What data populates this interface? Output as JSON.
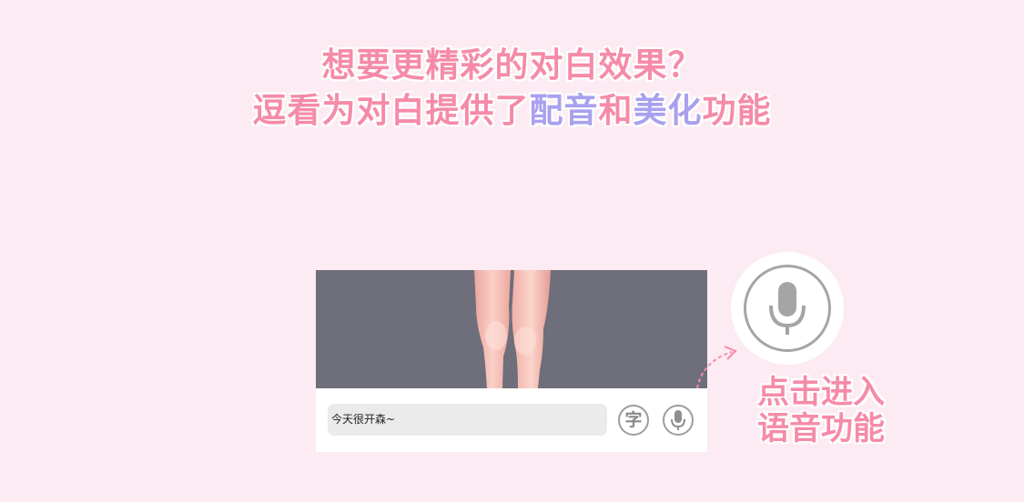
{
  "headline": {
    "line1": "想要更精彩的对白效果？",
    "line2_prefix": "逗看为对白提供了",
    "line2_hl1": "配音",
    "line2_mid": "和",
    "line2_hl2": "美化",
    "line2_suffix": "功能"
  },
  "chat_bar": {
    "input_value": "今天很开森~",
    "char_button_label": "字"
  },
  "callout": {
    "line1": "点击进入",
    "line2": "语音功能"
  },
  "icons": {
    "char_button": "text-style-icon",
    "mic_button": "microphone-icon",
    "big_mic": "microphone-icon"
  },
  "colors": {
    "background": "#fcebf3",
    "headline": "#f58ba8",
    "highlight": "#a9a0ee",
    "scene": "#6f6e7b"
  }
}
